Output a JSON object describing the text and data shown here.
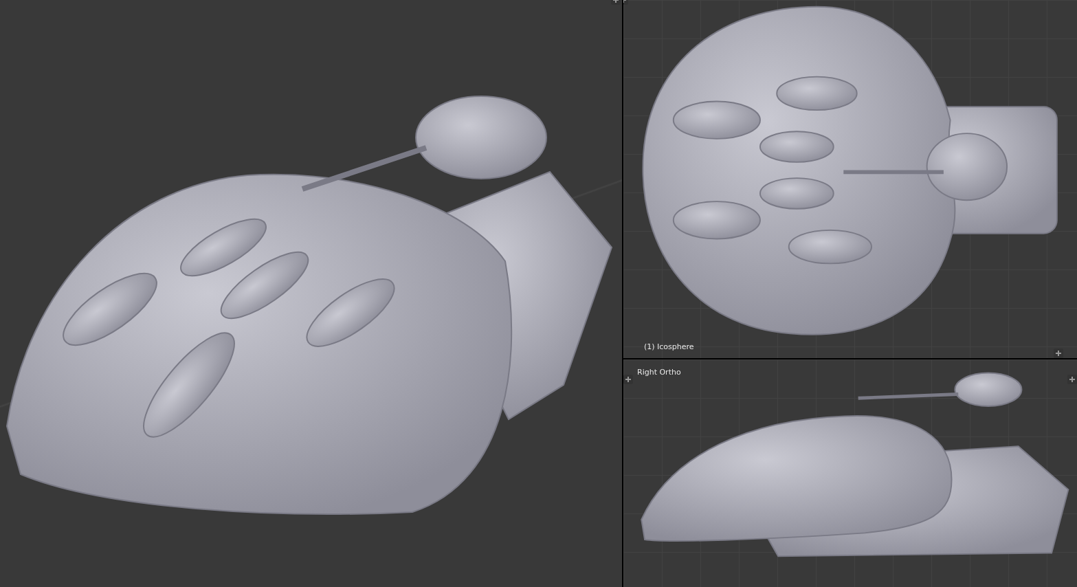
{
  "viewports": [
    {
      "kind": "perspective"
    },
    {
      "kind": "top",
      "object_label": "(1) Icosphere"
    },
    {
      "kind": "side",
      "view_label": "Right Ortho"
    }
  ]
}
